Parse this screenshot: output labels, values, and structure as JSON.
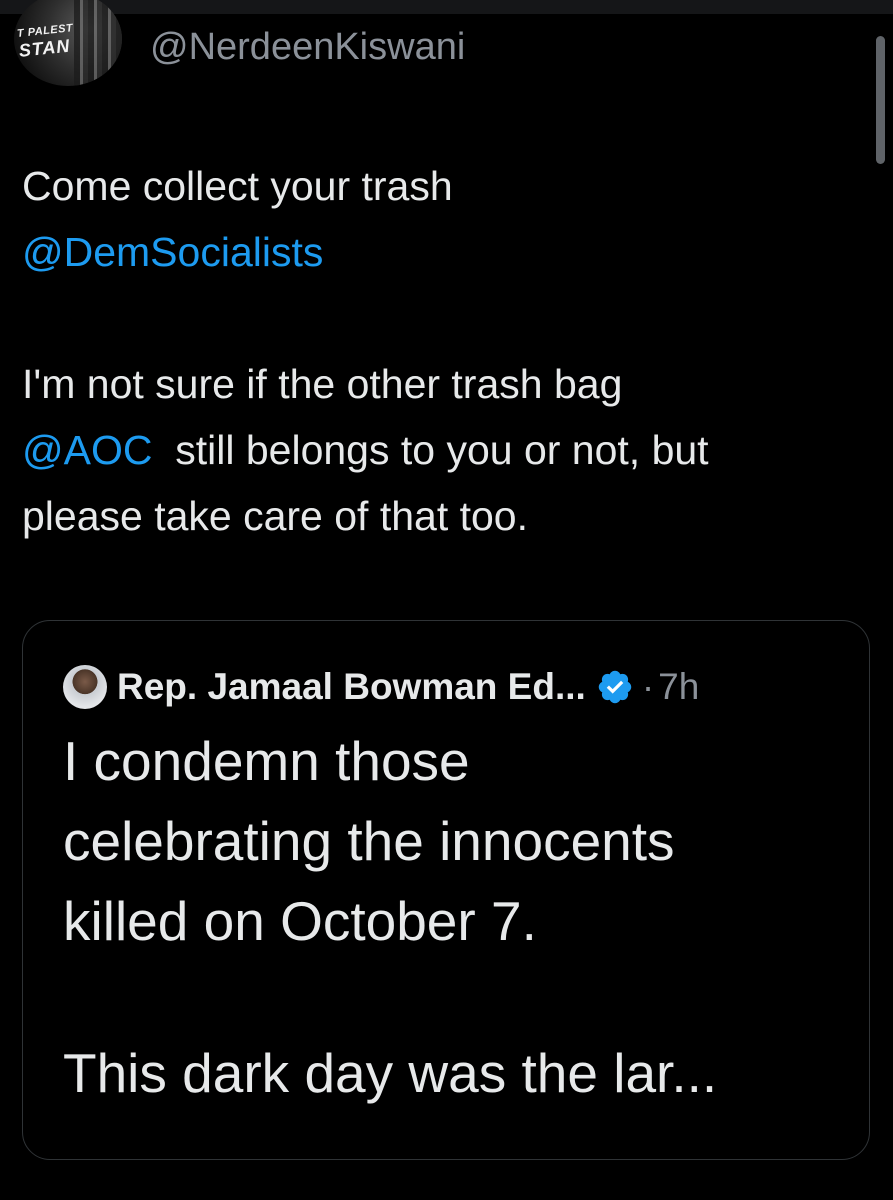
{
  "colors": {
    "background": "#000000",
    "text": "#e7e9ea",
    "secondary_text": "#8b9199",
    "link": "#1d9bf0",
    "border": "#2f3336",
    "verified_badge": "#1d9bf0"
  },
  "author": {
    "handle": "@NerdeenKiswani",
    "avatar_text_line1": "T PALEST",
    "avatar_text_line2": "STAN"
  },
  "tweet": {
    "line1": "Come collect your trash",
    "mention1": "@DemSocialists",
    "line3": "I'm not sure if the other trash bag",
    "mention2": "@AOC",
    "line4_rest": "  still belongs to you or not, but",
    "line5": "please take care of that too."
  },
  "quoted_tweet": {
    "author_name": "Rep. Jamaal Bowman Ed...",
    "separator": "·",
    "time": "7h",
    "verified_icon": "verified-badge-icon",
    "body_line1": "I condemn those",
    "body_line2": "celebrating the innocents",
    "body_line3": "killed on October 7.",
    "body_line4": "This dark day was the lar..."
  }
}
